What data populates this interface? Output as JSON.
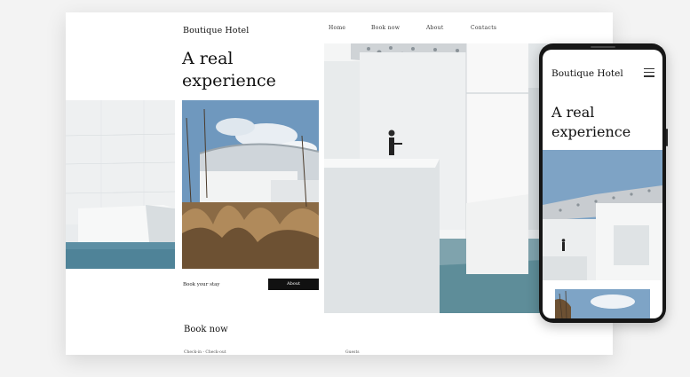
{
  "desktop": {
    "brand": "Boutique Hotel",
    "nav": [
      "Home",
      "Book now",
      "About",
      "Contacts"
    ],
    "hero_line1": "A real",
    "hero_line2": "experience",
    "book_stay_label": "Book your stay",
    "about_button": "About",
    "book_section_title": "Book now",
    "form_labels": [
      "Check-in - Check-out",
      "Guests"
    ]
  },
  "mobile": {
    "brand": "Boutique Hotel",
    "menu_icon": "hamburger-icon",
    "hero_line1": "A real",
    "hero_line2": "experience"
  },
  "colors": {
    "button_bg": "#111111",
    "water": "#5f8fa3",
    "sky": "#7ea4c6"
  }
}
